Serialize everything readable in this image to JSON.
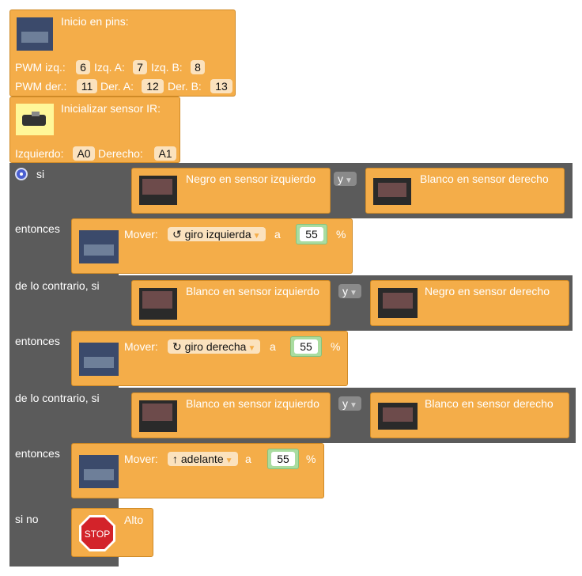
{
  "init_pins": {
    "title": "Inicio en pins:",
    "row1": {
      "pwm_izq_label": "PWM izq.:",
      "pwm_izq": "6",
      "izq_a_label": "Izq. A:",
      "izq_a": "7",
      "izq_b_label": "Izq. B:",
      "izq_b": "8"
    },
    "row2": {
      "pwm_der_label": "PWM der.:",
      "pwm_der": "11",
      "der_a_label": "Der. A:",
      "der_a": "12",
      "der_b_label": "Der. B:",
      "der_b": "13"
    }
  },
  "init_ir": {
    "title": "Inicializar sensor IR:",
    "izq_label": "Izquierdo:",
    "izq": "A0",
    "der_label": "Derecho:",
    "der": "A1"
  },
  "if_block": {
    "si_label": "si",
    "entonces_label": "entonces",
    "elseif_label": "de lo contrario, si",
    "else_label": "si no",
    "and_label": "y",
    "cond1": {
      "left": "Negro en sensor izquierdo",
      "right": "Blanco en sensor derecho"
    },
    "cond2": {
      "left": "Blanco en sensor izquierdo",
      "right": "Negro en sensor derecho"
    },
    "cond3": {
      "left": "Blanco en sensor izquierdo",
      "right": "Blanco en sensor derecho"
    },
    "move_label": "Mover:",
    "a_label": "a",
    "percent": "%",
    "move1": {
      "dir": "↺ giro izquierda",
      "value": "55"
    },
    "move2": {
      "dir": "↻ giro derecha",
      "value": "55"
    },
    "move3": {
      "dir": "↑ adelante",
      "value": "55"
    },
    "stop_label": "Alto",
    "stop_sign": "STOP"
  },
  "colors": {
    "block_orange": "#f4ad49",
    "field_bg": "#fbe2be",
    "control_gray": "#5b5b5b",
    "number_green": "#a9dca0"
  }
}
